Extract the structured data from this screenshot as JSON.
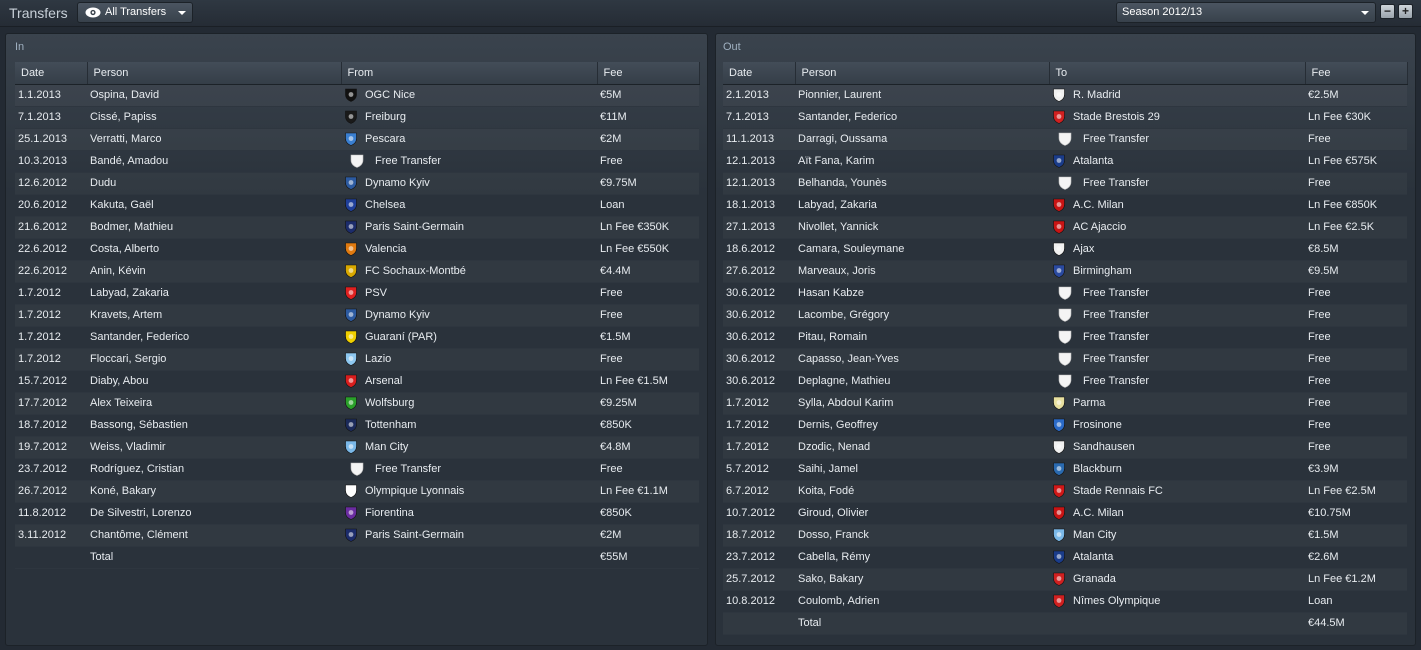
{
  "header": {
    "title": "Transfers",
    "filter_label": "All Transfers",
    "season_label": "Season 2012/13",
    "minus_label": "−",
    "plus_label": "+"
  },
  "in_panel": {
    "title": "In",
    "columns": [
      "Date",
      "Person",
      "From",
      "Fee"
    ],
    "rows": [
      {
        "date": "1.1.2013",
        "person": "Ospina, David",
        "club": "OGC Nice",
        "fee": "€5M",
        "crest": "#111111"
      },
      {
        "date": "7.1.2013",
        "person": "Cissé, Papiss",
        "club": "Freiburg",
        "fee": "€11M",
        "crest": "#1a1a1a"
      },
      {
        "date": "25.1.2013",
        "person": "Verratti, Marco",
        "club": "Pescara",
        "fee": "€2M",
        "crest": "#3a7fd0"
      },
      {
        "date": "10.3.2013",
        "person": "Bandé, Amadou",
        "club": "Free Transfer",
        "fee": "Free",
        "crest": "free"
      },
      {
        "date": "12.6.2012",
        "person": "Dudu",
        "club": "Dynamo Kyiv",
        "fee": "€9.75M",
        "crest": "#2c5aa0"
      },
      {
        "date": "20.6.2012",
        "person": "Kakuta, Gaël",
        "club": "Chelsea",
        "fee": "Loan",
        "crest": "#1f3f9a"
      },
      {
        "date": "21.6.2012",
        "person": "Bodmer, Mathieu",
        "club": "Paris Saint-Germain",
        "fee": "Ln Fee €350K",
        "crest": "#1c2c6b"
      },
      {
        "date": "22.6.2012",
        "person": "Costa, Alberto",
        "club": "Valencia",
        "fee": "Ln Fee €550K",
        "crest": "#e07a10"
      },
      {
        "date": "22.6.2012",
        "person": "Anin, Kévin",
        "club": "FC Sochaux-Montbé",
        "fee": "€4.4M",
        "crest": "#d8a800"
      },
      {
        "date": "1.7.2012",
        "person": "Labyad, Zakaria",
        "club": "PSV",
        "fee": "Free",
        "crest": "#e02020"
      },
      {
        "date": "1.7.2012",
        "person": "Kravets, Artem",
        "club": "Dynamo Kyiv",
        "fee": "Free",
        "crest": "#2c5aa0"
      },
      {
        "date": "1.7.2012",
        "person": "Santander, Federico",
        "club": "Guaraní (PAR)",
        "fee": "€1.5M",
        "crest": "#f0d000"
      },
      {
        "date": "1.7.2012",
        "person": "Floccari, Sergio",
        "club": "Lazio",
        "fee": "Free",
        "crest": "#8ec8f0"
      },
      {
        "date": "15.7.2012",
        "person": "Diaby, Abou",
        "club": "Arsenal",
        "fee": "Ln Fee €1.5M",
        "crest": "#d81e1e"
      },
      {
        "date": "17.7.2012",
        "person": "Alex Teixeira",
        "club": "Wolfsburg",
        "fee": "€9.25M",
        "crest": "#2aa02a"
      },
      {
        "date": "18.7.2012",
        "person": "Bassong, Sébastien",
        "club": "Tottenham",
        "fee": "€850K",
        "crest": "#1b2a5a"
      },
      {
        "date": "19.7.2012",
        "person": "Weiss, Vladimir",
        "club": "Man City",
        "fee": "€4.8M",
        "crest": "#7ab8e8"
      },
      {
        "date": "23.7.2012",
        "person": "Rodríguez, Cristian",
        "club": "Free Transfer",
        "fee": "Free",
        "crest": "free"
      },
      {
        "date": "26.7.2012",
        "person": "Koné, Bakary",
        "club": "Olympique Lyonnais",
        "fee": "Ln Fee €1.1M",
        "crest": "#ffffff"
      },
      {
        "date": "11.8.2012",
        "person": "De Silvestri, Lorenzo",
        "club": "Fiorentina",
        "fee": "€850K",
        "crest": "#6a2ca0"
      },
      {
        "date": "3.11.2012",
        "person": "Chantôme, Clément",
        "club": "Paris Saint-Germain",
        "fee": "€2M",
        "crest": "#1c2c6b"
      }
    ],
    "total_label": "Total",
    "total_fee": "€55M"
  },
  "out_panel": {
    "title": "Out",
    "columns": [
      "Date",
      "Person",
      "To",
      "Fee"
    ],
    "rows": [
      {
        "date": "2.1.2013",
        "person": "Pionnier, Laurent",
        "club": "R. Madrid",
        "fee": "€2.5M",
        "crest": "#f0f0f0"
      },
      {
        "date": "7.1.2013",
        "person": "Santander, Federico",
        "club": "Stade Brestois 29",
        "fee": "Ln Fee €30K",
        "crest": "#d02020"
      },
      {
        "date": "11.1.2013",
        "person": "Darragi, Oussama",
        "club": "Free Transfer",
        "fee": "Free",
        "crest": "free"
      },
      {
        "date": "12.1.2013",
        "person": "Aït Fana, Karim",
        "club": "Atalanta",
        "fee": "Ln Fee €575K",
        "crest": "#1a3c8a"
      },
      {
        "date": "12.1.2013",
        "person": "Belhanda, Younès",
        "club": "Free Transfer",
        "fee": "Free",
        "crest": "free"
      },
      {
        "date": "18.1.2013",
        "person": "Labyad, Zakaria",
        "club": "A.C. Milan",
        "fee": "Ln Fee €850K",
        "crest": "#c81414"
      },
      {
        "date": "27.1.2013",
        "person": "Nivollet, Yannick",
        "club": "AC Ajaccio",
        "fee": "Ln Fee €2.5K",
        "crest": "#c81414"
      },
      {
        "date": "18.6.2012",
        "person": "Camara, Souleymane",
        "club": "Ajax",
        "fee": "€8.5M",
        "crest": "#f0f0f0"
      },
      {
        "date": "27.6.2012",
        "person": "Marveaux, Joris",
        "club": "Birmingham",
        "fee": "€9.5M",
        "crest": "#2a4aa0"
      },
      {
        "date": "30.6.2012",
        "person": "Hasan Kabze",
        "club": "Free Transfer",
        "fee": "Free",
        "crest": "free"
      },
      {
        "date": "30.6.2012",
        "person": "Lacombe, Grégory",
        "club": "Free Transfer",
        "fee": "Free",
        "crest": "free"
      },
      {
        "date": "30.6.2012",
        "person": "Pitau, Romain",
        "club": "Free Transfer",
        "fee": "Free",
        "crest": "free"
      },
      {
        "date": "30.6.2012",
        "person": "Capasso, Jean-Yves",
        "club": "Free Transfer",
        "fee": "Free",
        "crest": "free"
      },
      {
        "date": "30.6.2012",
        "person": "Deplagne, Mathieu",
        "club": "Free Transfer",
        "fee": "Free",
        "crest": "free"
      },
      {
        "date": "1.7.2012",
        "person": "Sylla, Abdoul Karim",
        "club": "Parma",
        "fee": "Free",
        "crest": "#e8e0a0"
      },
      {
        "date": "1.7.2012",
        "person": "Dernis, Geoffrey",
        "club": "Frosinone",
        "fee": "Free",
        "crest": "#2a6ac8"
      },
      {
        "date": "1.7.2012",
        "person": "Dzodic, Nenad",
        "club": "Sandhausen",
        "fee": "Free",
        "crest": "#f0f0f0"
      },
      {
        "date": "5.7.2012",
        "person": "Saihi, Jamel",
        "club": "Blackburn",
        "fee": "€3.9M",
        "crest": "#2a6ab0"
      },
      {
        "date": "6.7.2012",
        "person": "Koita, Fodé",
        "club": "Stade Rennais FC",
        "fee": "Ln Fee €2.5M",
        "crest": "#d01818"
      },
      {
        "date": "10.7.2012",
        "person": "Giroud, Olivier",
        "club": "A.C. Milan",
        "fee": "€10.75M",
        "crest": "#c81414"
      },
      {
        "date": "18.7.2012",
        "person": "Dosso, Franck",
        "club": "Man City",
        "fee": "€1.5M",
        "crest": "#7ab8e8"
      },
      {
        "date": "23.7.2012",
        "person": "Cabella, Rémy",
        "club": "Atalanta",
        "fee": "€2.6M",
        "crest": "#1a3c8a"
      },
      {
        "date": "25.7.2012",
        "person": "Sako, Bakary",
        "club": "Granada",
        "fee": "Ln Fee €1.2M",
        "crest": "#d02020"
      },
      {
        "date": "10.8.2012",
        "person": "Coulomb, Adrien",
        "club": "Nîmes Olympique",
        "fee": "Loan",
        "crest": "#d02020"
      }
    ],
    "total_label": "Total",
    "total_fee": "€44.5M"
  }
}
